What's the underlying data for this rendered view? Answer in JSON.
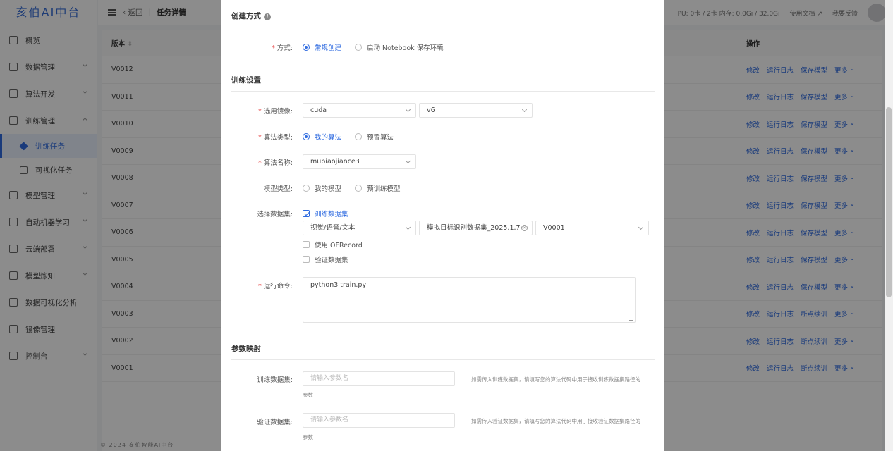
{
  "app": {
    "logo": "亥伯AI中台"
  },
  "sidebar": {
    "items": [
      {
        "label": "概览",
        "has_children": false
      },
      {
        "label": "数据管理",
        "has_children": true
      },
      {
        "label": "算法开发",
        "has_children": true
      },
      {
        "label": "训练管理",
        "has_children": true,
        "expanded": true
      },
      {
        "label": "模型管理",
        "has_children": true
      },
      {
        "label": "自动机器学习",
        "has_children": true
      },
      {
        "label": "云端部署",
        "has_children": true
      },
      {
        "label": "模型炼知",
        "has_children": true
      },
      {
        "label": "数据可视化分析",
        "has_children": false
      },
      {
        "label": "镜像管理",
        "has_children": false
      },
      {
        "label": "控制台",
        "has_children": true
      }
    ],
    "training_sub": [
      {
        "label": "训练任务",
        "active": true
      },
      {
        "label": "可视化任务",
        "active": false
      }
    ]
  },
  "topbar": {
    "back_label": "返回",
    "page_title": "任务详情",
    "resource_info": "PU: 0卡 / 2卡 内存: 0.0Gi / 32.0Gi",
    "docs_label": "使用文档",
    "feedback_label": "我要反馈"
  },
  "table": {
    "version_header": "版本",
    "ops_header": "操作",
    "rows": [
      {
        "version": "V0012",
        "ops": [
          "修改",
          "运行日志",
          "保存模型",
          "更多"
        ]
      },
      {
        "version": "V0011",
        "ops": [
          "修改",
          "运行日志",
          "保存模型",
          "更多"
        ]
      },
      {
        "version": "V0010",
        "ops": [
          "修改",
          "运行日志",
          "保存模型",
          "更多"
        ]
      },
      {
        "version": "V0009",
        "ops": [
          "修改",
          "运行日志",
          "保存模型",
          "更多"
        ]
      },
      {
        "version": "V0008",
        "ops": [
          "修改",
          "运行日志",
          "保存模型",
          "更多"
        ]
      },
      {
        "version": "V0007",
        "ops": [
          "修改",
          "运行日志",
          "保存模型",
          "更多"
        ]
      },
      {
        "version": "V0006",
        "ops": [
          "修改",
          "运行日志",
          "保存模型",
          "更多"
        ]
      },
      {
        "version": "V0005",
        "ops": [
          "修改",
          "运行日志",
          "保存模型",
          "更多"
        ]
      },
      {
        "version": "V0004",
        "ops": [
          "修改",
          "运行日志",
          "保存模型",
          "更多"
        ]
      },
      {
        "version": "V0003",
        "ops": [
          "修改",
          "运行日志",
          "断点续训",
          "更多"
        ]
      },
      {
        "version": "V0002",
        "ops": [
          "修改",
          "运行日志",
          "断点续训",
          "更多"
        ]
      },
      {
        "version": "V0001",
        "ops": [
          "修改",
          "运行日志",
          "断点续训",
          "更多"
        ]
      }
    ]
  },
  "footer": {
    "copyright": "© 2024 亥伯智能AI中台"
  },
  "modal": {
    "create_method": {
      "title": "创建方式",
      "label": "方式:",
      "options": [
        "常规创建",
        "启动 Notebook 保存环境"
      ],
      "selected": 0
    },
    "training": {
      "title": "训练设置",
      "image_label": "选用镜像:",
      "image_name": "cuda",
      "image_tag": "v6",
      "algo_type_label": "算法类型:",
      "algo_type_options": [
        "我的算法",
        "预置算法"
      ],
      "algo_type_selected": 0,
      "algo_name_label": "算法名称:",
      "algo_name": "mubiaojiance3",
      "model_type_label": "模型类型:",
      "model_type_options": [
        "我的模型",
        "预训练模型"
      ],
      "dataset_label": "选择数据集:",
      "train_dataset_check": "训练数据集",
      "dataset_kind": "视觉/语音/文本",
      "dataset_name": "模拟目标识别数据集_2025.1.7-",
      "dataset_version": "V0001",
      "ofrecord_check": "使用 OFRecord",
      "val_dataset_check": "验证数据集",
      "cmd_label": "运行命令:",
      "cmd_value": "python3 train.py"
    },
    "param_map": {
      "title": "参数映射",
      "train_label": "训练数据集:",
      "train_placeholder": "请输入参数名",
      "train_hint": "如需传入训练数据集，请填写您的算法代码中用于接收训练数据集路径的",
      "train_hint_sub": "参数",
      "val_label": "验证数据集:",
      "val_placeholder": "请输入参数名",
      "val_hint": "如需传入验证数据集，请填写您的算法代码中用于接收验证数据集路径的",
      "val_hint_sub": "参数"
    }
  }
}
